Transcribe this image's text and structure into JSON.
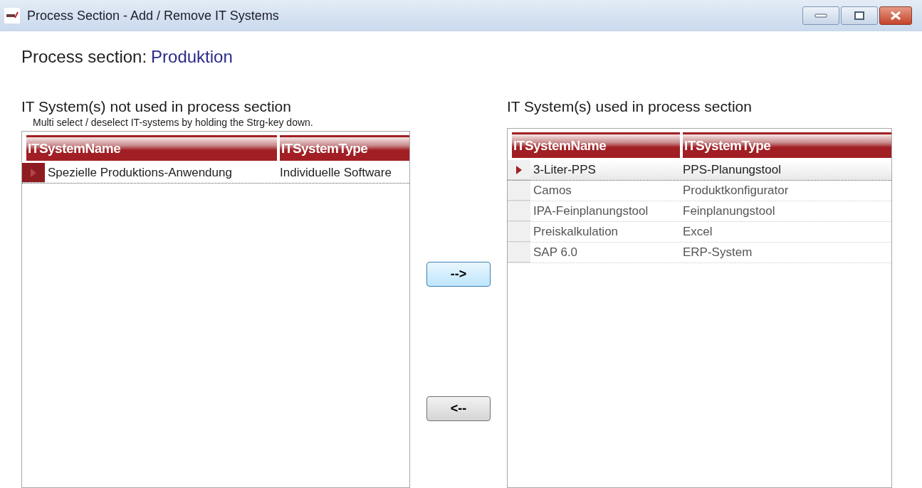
{
  "window": {
    "title": "Process Section - Add / Remove IT Systems"
  },
  "section": {
    "label": "Process section:",
    "value": "Produktion"
  },
  "left_panel": {
    "heading": "IT System(s) not used in process section",
    "hint": "Multi select / deselect IT-systems by holding the Strg-key down.",
    "columns": [
      "ITSystemName",
      "ITSystemType"
    ],
    "rows": [
      {
        "cells": [
          "Spezielle Produktions-Anwendung",
          "Individuelle Software"
        ],
        "selected": true
      }
    ]
  },
  "buttons": [
    {
      "label": "-->",
      "focused": true
    },
    {
      "label": "<--",
      "focused": false
    }
  ],
  "right_panel": {
    "heading": "IT System(s) used in process section",
    "columns": [
      "ITSystemName",
      "ITSystemType"
    ],
    "rows": [
      {
        "cells": [
          "3-Liter-PPS",
          "PPS-Planungstool"
        ],
        "selected": true
      },
      {
        "cells": [
          "Camos",
          "Produktkonfigurator"
        ],
        "selected": false
      },
      {
        "cells": [
          "IPA-Feinplanungstool",
          "Feinplanungstool"
        ],
        "selected": false
      },
      {
        "cells": [
          "Preiskalkulation",
          "Excel"
        ],
        "selected": false
      },
      {
        "cells": [
          "SAP 6.0",
          "ERP-System"
        ],
        "selected": false
      }
    ]
  }
}
